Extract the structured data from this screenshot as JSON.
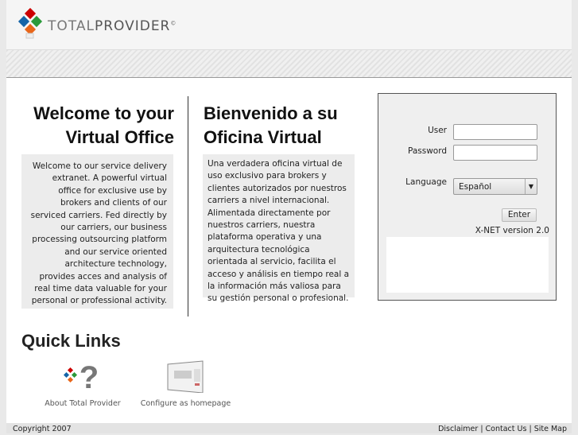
{
  "header": {
    "logo_text_light": "Total",
    "logo_text_dark": "Provider",
    "logo_mark": "©"
  },
  "english": {
    "title_line1": "Welcome to your",
    "title_line2": "Virtual Office",
    "body": "Welcome to our service delivery extranet. A powerful virtual office for exclusive use by brokers and clients of our serviced carriers. Fed directly by our carriers, our business processing outsourcing platform and our service oriented architecture technology, provides acces and analysis of real time data valuable for your personal or professional activity."
  },
  "spanish": {
    "title_line1": "Bienvenido a su",
    "title_line2": "Oficina Virtual",
    "body": "Una verdadera oficina virtual de uso exclusivo para brokers y clientes autorizados por nuestros carriers a nivel internacional. Alimentada directamente por nuestros carriers, nuestra plataforma operativa y una arquitectura tecnológica orientada al servicio, facilita el acceso y análisis en tiempo real a la información más valiosa para su gestión personal o profesional."
  },
  "login": {
    "user_label": "User",
    "user_value": "",
    "password_label": "Password",
    "password_value": "",
    "language_label": "Language",
    "language_selected": "Español",
    "enter_label": "Enter",
    "version": "X-NET version 2.0"
  },
  "quick_links": {
    "title": "Quick Links",
    "items": [
      {
        "label": "About Total Provider",
        "icon": "help-logo-icon"
      },
      {
        "label": "Configure as homepage",
        "icon": "homepage-screenshot-icon"
      }
    ]
  },
  "footer": {
    "copyright": "Copyright 2007",
    "links": [
      "Disclaimer",
      "Contact Us",
      "Site Map"
    ],
    "separator": " | "
  }
}
